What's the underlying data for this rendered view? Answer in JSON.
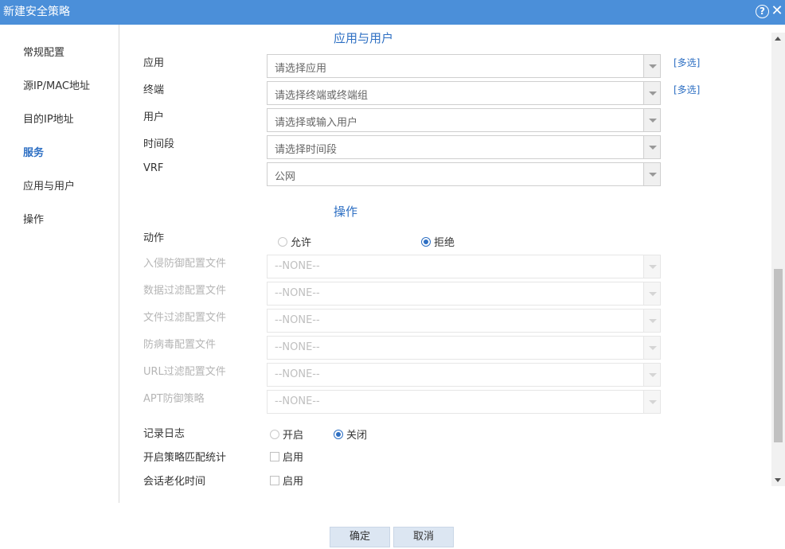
{
  "window": {
    "title": "新建安全策略"
  },
  "sidebar": {
    "items": [
      {
        "label": "常规配置"
      },
      {
        "label": "源IP/MAC地址"
      },
      {
        "label": "目的IP地址"
      },
      {
        "label": "服务",
        "active": true
      },
      {
        "label": "应用与用户"
      },
      {
        "label": "操作"
      }
    ]
  },
  "app_user": {
    "title": "应用与用户",
    "multi_label": "[多选]",
    "fields": [
      {
        "label": "应用",
        "value": "请选择应用"
      },
      {
        "label": "终端",
        "value": "请选择终端或终端组"
      },
      {
        "label": "用户",
        "value": "请选择或输入用户"
      },
      {
        "label": "时间段",
        "value": "请选择时间段"
      },
      {
        "label": "VRF",
        "value": "公网"
      }
    ]
  },
  "operation": {
    "title": "操作",
    "action": {
      "label": "动作",
      "options": [
        "允许",
        "拒绝"
      ],
      "selected": "拒绝"
    },
    "profiles": [
      {
        "label": "入侵防御配置文件",
        "value": "--NONE--"
      },
      {
        "label": "数据过滤配置文件",
        "value": "--NONE--"
      },
      {
        "label": "文件过滤配置文件",
        "value": "--NONE--"
      },
      {
        "label": "防病毒配置文件",
        "value": "--NONE--"
      },
      {
        "label": "URL过滤配置文件",
        "value": "--NONE--"
      },
      {
        "label": "APT防御策略",
        "value": "--NONE--"
      }
    ],
    "logging": {
      "label": "记录日志",
      "options": [
        "开启",
        "关闭"
      ],
      "selected": "关闭"
    },
    "policy_stats": {
      "label": "开启策略匹配统计",
      "checkbox": "启用",
      "checked": false
    },
    "session_aging": {
      "label": "会话老化时间",
      "checkbox": "启用",
      "checked": false
    }
  },
  "footer": {
    "ok": "确定",
    "cancel": "取消"
  }
}
